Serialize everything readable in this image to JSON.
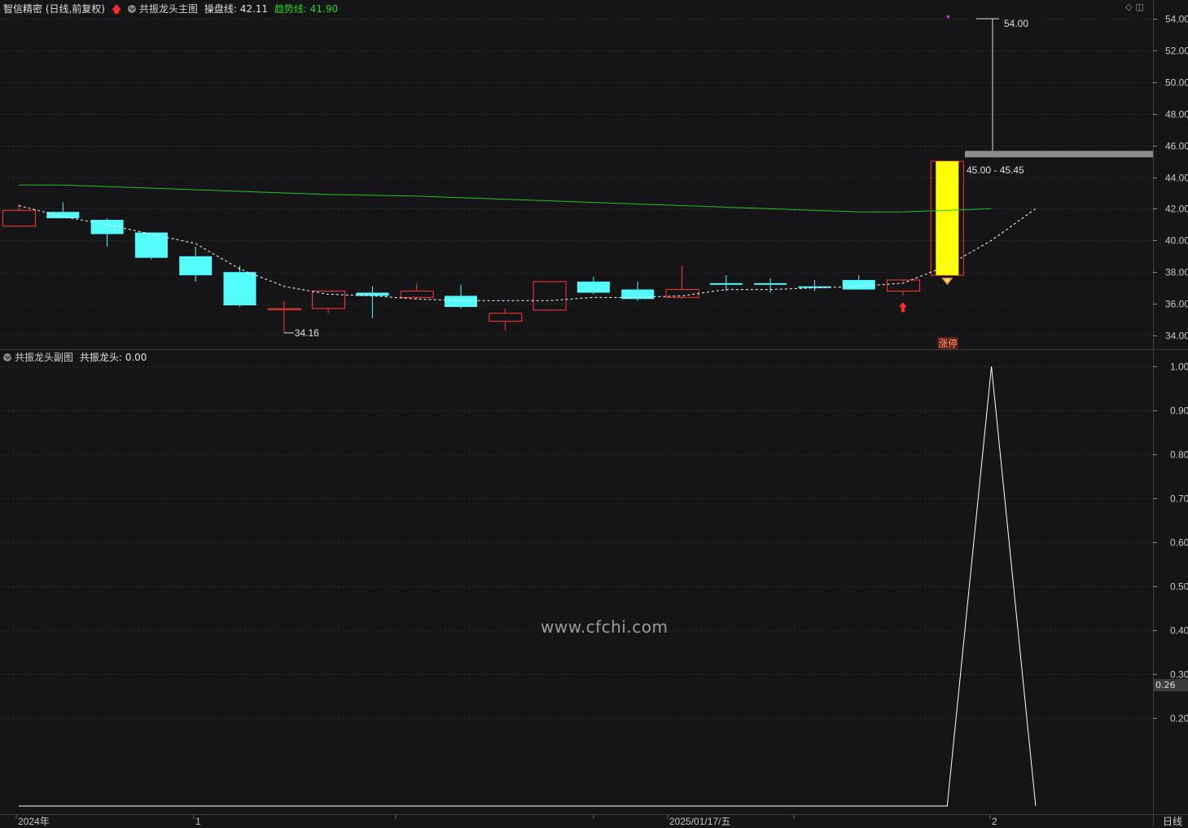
{
  "main_header": {
    "title": "智信精密 (日线,前复权)",
    "indicator_name": "共振龙头主图",
    "line1_label": "操盘线: 42.11",
    "line2_label": "趋势线: 41.90"
  },
  "sub_header": {
    "indicator_name": "共振龙头副图",
    "value_label": "共振龙头: 0.00"
  },
  "period_label": "日线",
  "watermark": "www.cfchi.com",
  "current_value_label": "0.26",
  "colors": {
    "background": "#151417",
    "up_candle": "#ff3838",
    "down_candle": "#54fcfc",
    "limit_up_fill": "#ffff00",
    "trend_line": "#25c225",
    "operation_line": "#ffffff",
    "signal_arrow": "#ff2a2a"
  },
  "chart_data": [
    {
      "type": "candlestick",
      "name": "main",
      "ylim": [
        33.5,
        55.0
      ],
      "y_ticks": [
        34,
        36,
        38,
        40,
        42,
        44,
        46,
        48,
        50,
        52,
        54
      ],
      "y_tick_labels": [
        "34.00",
        "36.00",
        "38.00",
        "40.00",
        "42.00",
        "44.00",
        "46.00",
        "48.00",
        "50.00",
        "52.00",
        "54.00"
      ],
      "candles": [
        {
          "o": 40.9,
          "h": 42.3,
          "l": 40.9,
          "c": 41.9
        },
        {
          "o": 41.8,
          "h": 42.4,
          "l": 41.4,
          "c": 41.4
        },
        {
          "o": 41.3,
          "h": 41.4,
          "l": 39.6,
          "c": 40.4
        },
        {
          "o": 40.5,
          "h": 40.5,
          "l": 38.8,
          "c": 38.9
        },
        {
          "o": 39.0,
          "h": 39.6,
          "l": 37.4,
          "c": 37.8
        },
        {
          "o": 38.0,
          "h": 38.4,
          "l": 35.8,
          "c": 35.9
        },
        {
          "o": 35.7,
          "h": 36.2,
          "l": 34.16,
          "c": 35.7
        },
        {
          "o": 35.7,
          "h": 36.8,
          "l": 35.4,
          "c": 36.8
        },
        {
          "o": 36.7,
          "h": 37.1,
          "l": 35.1,
          "c": 36.5
        },
        {
          "o": 36.4,
          "h": 37.3,
          "l": 36.3,
          "c": 36.8
        },
        {
          "o": 36.5,
          "h": 37.2,
          "l": 35.7,
          "c": 35.8
        },
        {
          "o": 34.9,
          "h": 35.7,
          "l": 34.3,
          "c": 35.4
        },
        {
          "o": 35.6,
          "h": 37.4,
          "l": 35.6,
          "c": 37.4
        },
        {
          "o": 37.4,
          "h": 37.7,
          "l": 36.6,
          "c": 36.7
        },
        {
          "o": 36.9,
          "h": 37.4,
          "l": 36.2,
          "c": 36.3
        },
        {
          "o": 36.4,
          "h": 38.4,
          "l": 36.3,
          "c": 36.9
        },
        {
          "o": 37.3,
          "h": 37.8,
          "l": 36.8,
          "c": 37.2
        },
        {
          "o": 37.3,
          "h": 37.6,
          "l": 36.7,
          "c": 37.2
        },
        {
          "o": 37.1,
          "h": 37.5,
          "l": 36.8,
          "c": 37.0
        },
        {
          "o": 37.5,
          "h": 37.8,
          "l": 36.9,
          "c": 36.9
        },
        {
          "o": 36.8,
          "h": 37.4,
          "l": 36.5,
          "c": 37.5
        },
        {
          "o": 37.8,
          "h": 45.0,
          "l": 37.8,
          "c": 45.0
        }
      ],
      "limit_up_index": 21,
      "trend_line": [
        43.5,
        43.5,
        43.4,
        43.3,
        43.2,
        43.1,
        43.0,
        42.9,
        42.85,
        42.8,
        42.7,
        42.6,
        42.5,
        42.4,
        42.3,
        42.2,
        42.1,
        42.0,
        41.9,
        41.8,
        41.8,
        41.9,
        42.0
      ],
      "operation_line": [
        42.2,
        41.5,
        41.0,
        40.4,
        39.8,
        38.2,
        37.1,
        36.6,
        36.5,
        36.3,
        36.2,
        36.2,
        36.2,
        36.4,
        36.4,
        36.5,
        36.9,
        36.9,
        37.0,
        37.1,
        37.3,
        38.4,
        40.0,
        42.0
      ],
      "annotations": {
        "low_label": "34.16",
        "high_label": "54.00",
        "range_label": "45.00 - 45.45",
        "limit_up_tag": "涨停"
      },
      "signal_arrow_index": 20,
      "range_band": [
        45.0,
        45.45
      ],
      "high_value": 54.0
    },
    {
      "type": "line",
      "name": "sub",
      "ylim": [
        0.0,
        1.05
      ],
      "y_ticks": [
        0.2,
        0.3,
        0.4,
        0.5,
        0.6,
        0.7,
        0.8,
        0.9,
        1.0
      ],
      "y_tick_labels": [
        "0.20",
        "0.30",
        "0.40",
        "0.50",
        "0.60",
        "0.70",
        "0.80",
        "0.90",
        "1.00"
      ],
      "values": [
        0,
        0,
        0,
        0,
        0,
        0,
        0,
        0,
        0,
        0,
        0,
        0,
        0,
        0,
        0,
        0,
        0,
        0,
        0,
        0,
        0,
        0,
        1,
        0
      ]
    }
  ],
  "x_axis_labels": [
    "2024年",
    "1",
    "2025/01/17/五",
    "2"
  ]
}
